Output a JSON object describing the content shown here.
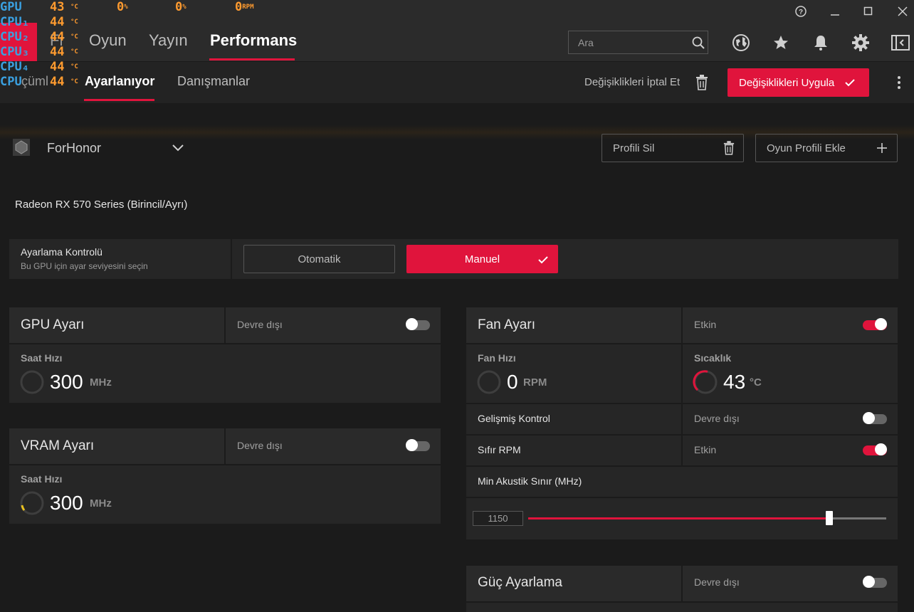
{
  "osd": {
    "rows": [
      {
        "label": "GPU",
        "value": "43",
        "unit": "°C"
      },
      {
        "label": "CPU₁",
        "value": "44",
        "unit": "°C"
      },
      {
        "label": "CPU₂",
        "value": "44",
        "unit": "°C"
      },
      {
        "label": "CPU₃",
        "value": "44",
        "unit": "°C"
      },
      {
        "label": "CPU₄",
        "value": "44",
        "unit": "°C"
      },
      {
        "label": "CPU",
        "value": "44",
        "unit": "°C"
      }
    ],
    "extra": [
      {
        "value": "0",
        "unit": "%"
      },
      {
        "value": "0",
        "unit": "%"
      },
      {
        "value": "0",
        "unit": "RPM"
      }
    ]
  },
  "nav": {
    "tabs": [
      "Oyun",
      "Yayın",
      "Performans"
    ],
    "partial_tab": "Fr",
    "search_placeholder": "Ara"
  },
  "subnav": {
    "partial_tab": "çüml",
    "tabs": [
      "Ayarlanıyor",
      "Danışmanlar"
    ],
    "cancel_label": "Değişiklikleri İptal Et",
    "apply_label": "Değişiklikleri Uygula"
  },
  "profile": {
    "name": "ForHonor",
    "delete_label": "Profili Sil",
    "add_label": "Oyun Profili Ekle"
  },
  "gpu_name": "Radeon RX 570 Series (Birincil/Ayrı)",
  "tuning_control": {
    "title": "Ayarlama Kontrolü",
    "subtitle": "Bu GPU için ayar seviyesini seçin",
    "auto_label": "Otomatik",
    "manual_label": "Manuel"
  },
  "gpu_tuning": {
    "title": "GPU Ayarı",
    "state": "Devre dışı",
    "metric_label": "Saat Hızı",
    "value": "300",
    "unit": "MHz"
  },
  "vram_tuning": {
    "title": "VRAM Ayarı",
    "state": "Devre dışı",
    "metric_label": "Saat Hızı",
    "value": "300",
    "unit": "MHz"
  },
  "fan_tuning": {
    "title": "Fan Ayarı",
    "state": "Etkin",
    "fan_speed_label": "Fan Hızı",
    "fan_speed_value": "0",
    "fan_speed_unit": "RPM",
    "temp_label": "Sıcaklık",
    "temp_value": "43",
    "temp_unit": "°C",
    "advanced_label": "Gelişmiş Kontrol",
    "advanced_state": "Devre dışı",
    "zero_rpm_label": "Sıfır RPM",
    "zero_rpm_state": "Etkin",
    "acoustic_label": "Min Akustik Sınır (MHz)",
    "acoustic_value": "1150",
    "acoustic_fraction": 0.84
  },
  "power_tuning": {
    "title": "Güç Ayarlama",
    "state": "Devre dışı"
  },
  "colors": {
    "accent": "#e0143c",
    "osd_label": "#3aa0e0",
    "osd_value": "#ff9b2f"
  }
}
